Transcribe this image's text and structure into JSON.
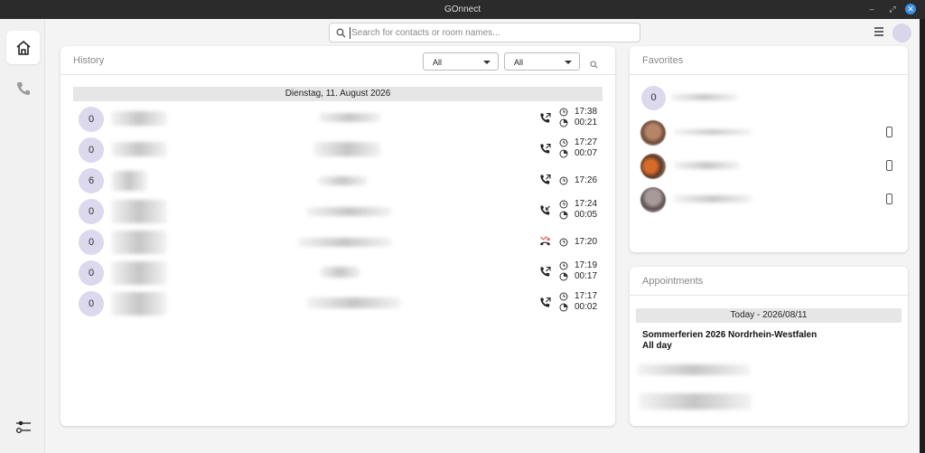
{
  "window": {
    "title": "GOnnect",
    "controls": [
      "–",
      "⤢",
      "✕"
    ]
  },
  "search": {
    "placeholder": "Search for contacts or room names..."
  },
  "sidebar": {
    "items": [
      {
        "name": "home",
        "icon": "home-icon",
        "active": true
      },
      {
        "name": "calls",
        "icon": "phone-icon",
        "active": false
      }
    ],
    "bottom_icon": "sliders-icon"
  },
  "history": {
    "title": "History",
    "filter1": "All",
    "filter2": "All",
    "date_header": "Dienstag, 11. August 2026",
    "calls": [
      {
        "count": "0",
        "type": "outgoing",
        "time": "17:38",
        "duration": "00:21"
      },
      {
        "count": "0",
        "type": "outgoing",
        "time": "17:27",
        "duration": "00:07"
      },
      {
        "count": "6",
        "type": "outgoing",
        "time": "17:26",
        "duration": ""
      },
      {
        "count": "0",
        "type": "incoming",
        "time": "17:24",
        "duration": "00:05"
      },
      {
        "count": "0",
        "type": "missed",
        "time": "17:20",
        "duration": ""
      },
      {
        "count": "0",
        "type": "outgoing",
        "time": "17:19",
        "duration": "00:17"
      },
      {
        "count": "0",
        "type": "outgoing",
        "time": "17:17",
        "duration": "00:02"
      }
    ]
  },
  "favorites": {
    "title": "Favorites",
    "items": [
      {
        "initial": "0",
        "has_photo": false,
        "has_phone": false
      },
      {
        "initial": "",
        "has_photo": true,
        "has_phone": true
      },
      {
        "initial": "",
        "has_photo": true,
        "has_phone": true
      },
      {
        "initial": "",
        "has_photo": true,
        "has_phone": true
      }
    ]
  },
  "appointments": {
    "title": "Appointments",
    "date_header": "Today - 2026/08/11",
    "event_title": "Sommerferien 2026 Nordrhein-Westfalen",
    "event_time": "All day"
  },
  "colors": {
    "accent": "#3d8fe0",
    "avatar_bg": "#dcd8ee",
    "missed": "#d9534f"
  }
}
